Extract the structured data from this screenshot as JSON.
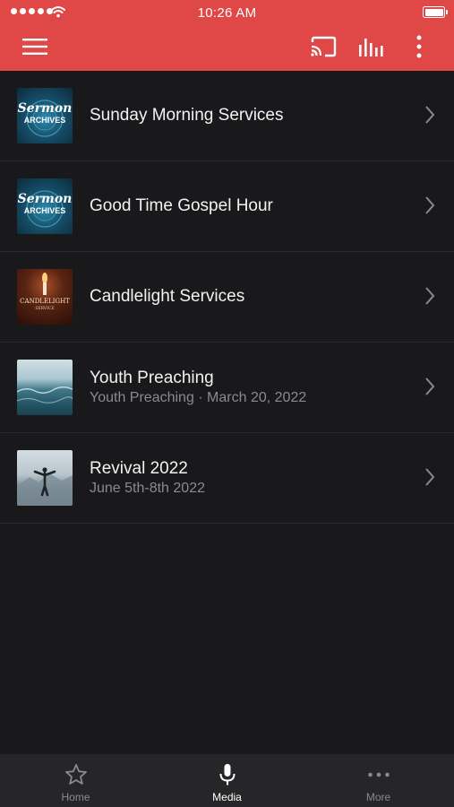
{
  "status_bar": {
    "time": "10:26 AM"
  },
  "toolbar": {
    "menu_icon": "hamburger-menu-icon",
    "cast_icon": "cast-icon",
    "equalizer_icon": "equalizer-icon",
    "more_icon": "vertical-dots-icon"
  },
  "list": {
    "items": [
      {
        "title": "Sunday Morning Services",
        "subtitle": "",
        "thumb": "sermon-archives",
        "thumb_text_1": "Sermon",
        "thumb_text_2": "ARCHIVES"
      },
      {
        "title": "Good Time Gospel Hour",
        "subtitle": "",
        "thumb": "sermon-archives",
        "thumb_text_1": "Sermon",
        "thumb_text_2": "ARCHIVES"
      },
      {
        "title": "Candlelight Services",
        "subtitle": "",
        "thumb": "candlelight",
        "thumb_text_1": "CANDLELIGHT",
        "thumb_text_2": "SERVICE"
      },
      {
        "title": "Youth Preaching",
        "subtitle": "Youth Preaching · March 20, 2022",
        "thumb": "ocean-waves"
      },
      {
        "title": "Revival 2022",
        "subtitle": "June 5th-8th 2022",
        "thumb": "mountain-person"
      }
    ]
  },
  "tabbar": {
    "tabs": [
      {
        "label": "Home",
        "icon": "star-icon",
        "active": false
      },
      {
        "label": "Media",
        "icon": "microphone-icon",
        "active": true
      },
      {
        "label": "More",
        "icon": "horizontal-dots-icon",
        "active": false
      }
    ]
  },
  "colors": {
    "header": "#e04848",
    "background": "#19191b",
    "tabbar": "#262628",
    "accent": "#ffffff"
  }
}
